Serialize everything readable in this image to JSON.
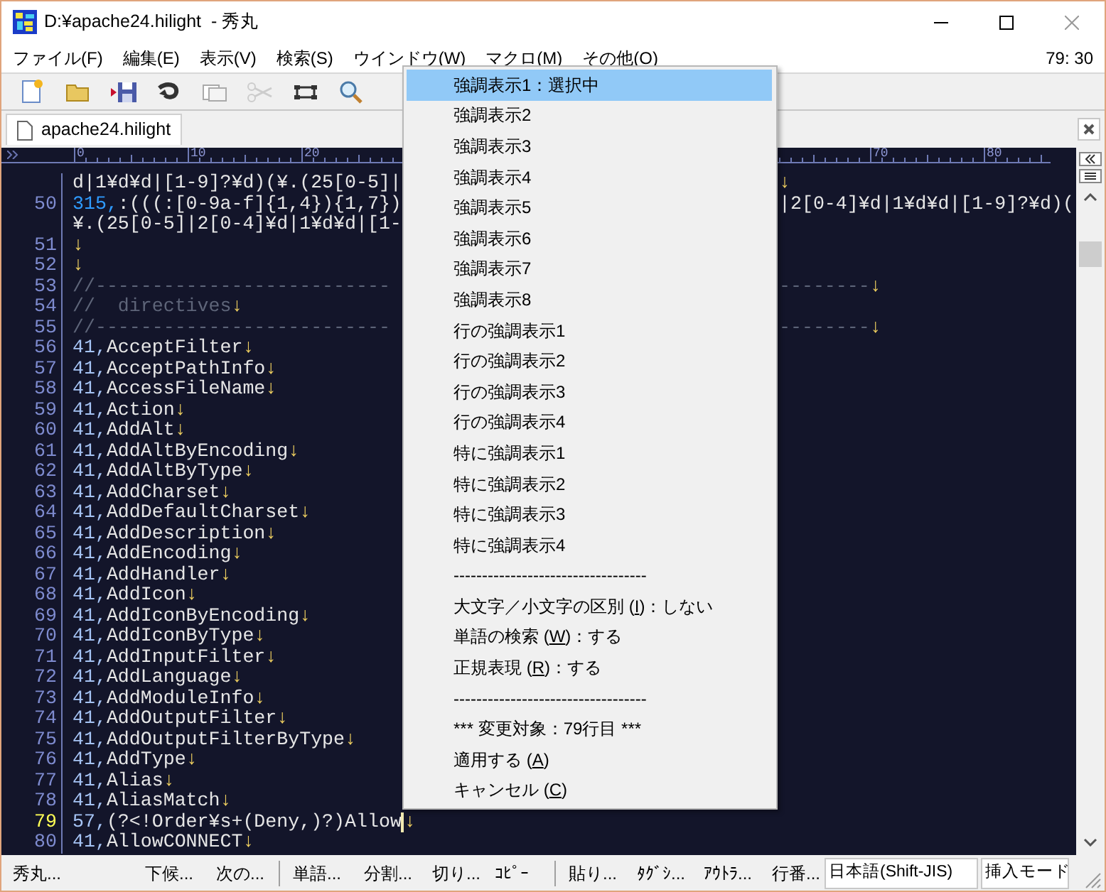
{
  "window": {
    "title": "D:¥apache24.hilight  - 秀丸"
  },
  "menu_bar": {
    "items": [
      {
        "label": "ファイル(F)"
      },
      {
        "label": "編集(E)"
      },
      {
        "label": "表示(V)"
      },
      {
        "label": "検索(S)"
      },
      {
        "label": "ウインドウ(W)"
      },
      {
        "label": "マクロ(M)"
      },
      {
        "label": "その他(O)"
      }
    ],
    "position": "79: 30"
  },
  "toolbar": [
    {
      "kind": "new"
    },
    {
      "kind": "open"
    },
    {
      "kind": "save"
    },
    {
      "kind": "redo"
    },
    {
      "kind": "window"
    },
    {
      "kind": "cut",
      "disabled": true
    },
    {
      "kind": "split"
    },
    {
      "kind": "search"
    }
  ],
  "tabs": [
    {
      "label": "apache24.hilight",
      "selected": true
    }
  ],
  "ruler": {
    "left_labels": [
      "0",
      "10",
      "20"
    ],
    "right_labels": [
      "70",
      "80"
    ]
  },
  "lines": [
    {
      "parts": [
        {
          "kind": "code",
          "text": "d|1¥d¥d|[1-9]?¥d)(¥.(25[0-5]|"
        }
      ],
      "tail": [
        {
          "kind": "eol",
          "text": "↓"
        }
      ]
    },
    {
      "number": "50",
      "parts": [
        {
          "kind": "special",
          "text": "315,"
        },
        {
          "kind": "code",
          "text": ":(((:[0-9a-f]{1,4}){1,7})"
        }
      ],
      "tail": [
        {
          "kind": "code",
          "text": "|2[0-4]¥d|1¥d¥d|[1-9]?¥d)("
        }
      ]
    },
    {
      "parts": [
        {
          "kind": "code",
          "text": "¥.(25[0-5]|2[0-4]¥d|1¥d¥d|[1-"
        }
      ]
    },
    {
      "number": "51",
      "parts": [
        {
          "kind": "eol",
          "text": "↓"
        }
      ]
    },
    {
      "number": "52",
      "parts": [
        {
          "kind": "eol",
          "text": "↓"
        }
      ]
    },
    {
      "number": "53",
      "parts": [
        {
          "kind": "comment",
          "text": "//--------------------------"
        }
      ],
      "tail": [
        {
          "kind": "comment",
          "text": "--------"
        },
        {
          "kind": "eol",
          "text": "↓"
        }
      ]
    },
    {
      "number": "54",
      "parts": [
        {
          "kind": "comment",
          "text": "//  directives"
        },
        {
          "kind": "eol",
          "text": "↓"
        }
      ]
    },
    {
      "number": "55",
      "parts": [
        {
          "kind": "comment",
          "text": "//--------------------------"
        }
      ],
      "tail": [
        {
          "kind": "comment",
          "text": "--------"
        },
        {
          "kind": "eol",
          "text": "↓"
        }
      ]
    },
    {
      "number": "56",
      "parts": [
        {
          "kind": "prefix",
          "text": "41,"
        },
        {
          "kind": "code",
          "text": "AcceptFilter"
        },
        {
          "kind": "eol",
          "text": "↓"
        }
      ]
    },
    {
      "number": "57",
      "parts": [
        {
          "kind": "prefix",
          "text": "41,"
        },
        {
          "kind": "code",
          "text": "AcceptPathInfo"
        },
        {
          "kind": "eol",
          "text": "↓"
        }
      ]
    },
    {
      "number": "58",
      "parts": [
        {
          "kind": "prefix",
          "text": "41,"
        },
        {
          "kind": "code",
          "text": "AccessFileName"
        },
        {
          "kind": "eol",
          "text": "↓"
        }
      ]
    },
    {
      "number": "59",
      "parts": [
        {
          "kind": "prefix",
          "text": "41,"
        },
        {
          "kind": "code",
          "text": "Action"
        },
        {
          "kind": "eol",
          "text": "↓"
        }
      ]
    },
    {
      "number": "60",
      "parts": [
        {
          "kind": "prefix",
          "text": "41,"
        },
        {
          "kind": "code",
          "text": "AddAlt"
        },
        {
          "kind": "eol",
          "text": "↓"
        }
      ]
    },
    {
      "number": "61",
      "parts": [
        {
          "kind": "prefix",
          "text": "41,"
        },
        {
          "kind": "code",
          "text": "AddAltByEncoding"
        },
        {
          "kind": "eol",
          "text": "↓"
        }
      ]
    },
    {
      "number": "62",
      "parts": [
        {
          "kind": "prefix",
          "text": "41,"
        },
        {
          "kind": "code",
          "text": "AddAltByType"
        },
        {
          "kind": "eol",
          "text": "↓"
        }
      ]
    },
    {
      "number": "63",
      "parts": [
        {
          "kind": "prefix",
          "text": "41,"
        },
        {
          "kind": "code",
          "text": "AddCharset"
        },
        {
          "kind": "eol",
          "text": "↓"
        }
      ]
    },
    {
      "number": "64",
      "parts": [
        {
          "kind": "prefix",
          "text": "41,"
        },
        {
          "kind": "code",
          "text": "AddDefaultCharset"
        },
        {
          "kind": "eol",
          "text": "↓"
        }
      ]
    },
    {
      "number": "65",
      "parts": [
        {
          "kind": "prefix",
          "text": "41,"
        },
        {
          "kind": "code",
          "text": "AddDescription"
        },
        {
          "kind": "eol",
          "text": "↓"
        }
      ]
    },
    {
      "number": "66",
      "parts": [
        {
          "kind": "prefix",
          "text": "41,"
        },
        {
          "kind": "code",
          "text": "AddEncoding"
        },
        {
          "kind": "eol",
          "text": "↓"
        }
      ]
    },
    {
      "number": "67",
      "parts": [
        {
          "kind": "prefix",
          "text": "41,"
        },
        {
          "kind": "code",
          "text": "AddHandler"
        },
        {
          "kind": "eol",
          "text": "↓"
        }
      ]
    },
    {
      "number": "68",
      "parts": [
        {
          "kind": "prefix",
          "text": "41,"
        },
        {
          "kind": "code",
          "text": "AddIcon"
        },
        {
          "kind": "eol",
          "text": "↓"
        }
      ]
    },
    {
      "number": "69",
      "parts": [
        {
          "kind": "prefix",
          "text": "41,"
        },
        {
          "kind": "code",
          "text": "AddIconByEncoding"
        },
        {
          "kind": "eol",
          "text": "↓"
        }
      ]
    },
    {
      "number": "70",
      "parts": [
        {
          "kind": "prefix",
          "text": "41,"
        },
        {
          "kind": "code",
          "text": "AddIconByType"
        },
        {
          "kind": "eol",
          "text": "↓"
        }
      ]
    },
    {
      "number": "71",
      "parts": [
        {
          "kind": "prefix",
          "text": "41,"
        },
        {
          "kind": "code",
          "text": "AddInputFilter"
        },
        {
          "kind": "eol",
          "text": "↓"
        }
      ]
    },
    {
      "number": "72",
      "parts": [
        {
          "kind": "prefix",
          "text": "41,"
        },
        {
          "kind": "code",
          "text": "AddLanguage"
        },
        {
          "kind": "eol",
          "text": "↓"
        }
      ]
    },
    {
      "number": "73",
      "parts": [
        {
          "kind": "prefix",
          "text": "41,"
        },
        {
          "kind": "code",
          "text": "AddModuleInfo"
        },
        {
          "kind": "eol",
          "text": "↓"
        }
      ]
    },
    {
      "number": "74",
      "parts": [
        {
          "kind": "prefix",
          "text": "41,"
        },
        {
          "kind": "code",
          "text": "AddOutputFilter"
        },
        {
          "kind": "eol",
          "text": "↓"
        }
      ]
    },
    {
      "number": "75",
      "parts": [
        {
          "kind": "prefix",
          "text": "41,"
        },
        {
          "kind": "code",
          "text": "AddOutputFilterByType"
        },
        {
          "kind": "eol",
          "text": "↓"
        }
      ]
    },
    {
      "number": "76",
      "parts": [
        {
          "kind": "prefix",
          "text": "41,"
        },
        {
          "kind": "code",
          "text": "AddType"
        },
        {
          "kind": "eol",
          "text": "↓"
        }
      ]
    },
    {
      "number": "77",
      "parts": [
        {
          "kind": "prefix",
          "text": "41,"
        },
        {
          "kind": "code",
          "text": "Alias"
        },
        {
          "kind": "eol",
          "text": "↓"
        }
      ]
    },
    {
      "number": "78",
      "parts": [
        {
          "kind": "prefix",
          "text": "41,"
        },
        {
          "kind": "code",
          "text": "AliasMatch"
        },
        {
          "kind": "eol",
          "text": "↓"
        }
      ]
    },
    {
      "number": "79",
      "current": true,
      "parts": [
        {
          "kind": "prefix",
          "text": "57,"
        },
        {
          "kind": "code",
          "text": "(?<!Order¥s+(Deny,)?)Allow"
        },
        {
          "kind": "eol",
          "text": "↓"
        }
      ]
    },
    {
      "number": "80",
      "parts": [
        {
          "kind": "prefix",
          "text": "41,"
        },
        {
          "kind": "code",
          "text": "AllowCONNECT"
        },
        {
          "kind": "eol",
          "text": "↓"
        }
      ]
    }
  ],
  "popup_menu": [
    {
      "kind": "item",
      "label": "強調表示1：選択中",
      "selected": true
    },
    {
      "kind": "item",
      "label": "強調表示2",
      "selected": false
    },
    {
      "kind": "item",
      "label": "強調表示3",
      "selected": false
    },
    {
      "kind": "item",
      "label": "強調表示4",
      "selected": false
    },
    {
      "kind": "item",
      "label": "強調表示5",
      "selected": false
    },
    {
      "kind": "item",
      "label": "強調表示6",
      "selected": false
    },
    {
      "kind": "item",
      "label": "強調表示7",
      "selected": false
    },
    {
      "kind": "item",
      "label": "強調表示8",
      "selected": false
    },
    {
      "kind": "item",
      "label": "行の強調表示1",
      "selected": false
    },
    {
      "kind": "item",
      "label": "行の強調表示2",
      "selected": false
    },
    {
      "kind": "item",
      "label": "行の強調表示3",
      "selected": false
    },
    {
      "kind": "item",
      "label": "行の強調表示4",
      "selected": false
    },
    {
      "kind": "item",
      "label": "特に強調表示1",
      "selected": false
    },
    {
      "kind": "item",
      "label": "特に強調表示2",
      "selected": false
    },
    {
      "kind": "item",
      "label": "特に強調表示3",
      "selected": false
    },
    {
      "kind": "item",
      "label": "特に強調表示4",
      "selected": false
    },
    {
      "kind": "separator",
      "label": "----------------------------------"
    },
    {
      "kind": "accel",
      "before": "大文字／小文字の区別 (",
      "key": "I",
      "after": ")：しない",
      "selected": false
    },
    {
      "kind": "accel",
      "before": "単語の検索 (",
      "key": "W",
      "after": ")：する",
      "selected": false
    },
    {
      "kind": "accel",
      "before": "正規表現 (",
      "key": "R",
      "after": ")：する",
      "selected": false
    },
    {
      "kind": "separator",
      "label": "----------------------------------"
    },
    {
      "kind": "info",
      "label": "*** 変更対象：79行目 ***"
    },
    {
      "kind": "accel",
      "before": "適用する (",
      "key": "A",
      "after": ")",
      "selected": false
    },
    {
      "kind": "accel",
      "before": "キャンセル (",
      "key": "C",
      "after": ")",
      "selected": false
    }
  ],
  "status_bar": [
    {
      "kind": "button",
      "label": "秀丸..."
    },
    {
      "kind": "button",
      "label": "下候..."
    },
    {
      "kind": "button",
      "label": "次の..."
    },
    {
      "kind": "divider"
    },
    {
      "kind": "button",
      "label": "単語..."
    },
    {
      "kind": "button",
      "label": "分割..."
    },
    {
      "kind": "button",
      "label": "切り..."
    },
    {
      "kind": "button",
      "label": "ｺﾋﾟｰ"
    },
    {
      "kind": "divider"
    },
    {
      "kind": "button",
      "label": "貼り..."
    },
    {
      "kind": "button",
      "label": "ﾀｸﾞｼ..."
    },
    {
      "kind": "button",
      "label": "ｱｳﾄﾗ..."
    },
    {
      "kind": "button",
      "label": "行番..."
    },
    {
      "kind": "panel",
      "label": "日本語(Shift-JIS)"
    },
    {
      "kind": "panel",
      "label": "挿入モード"
    }
  ]
}
